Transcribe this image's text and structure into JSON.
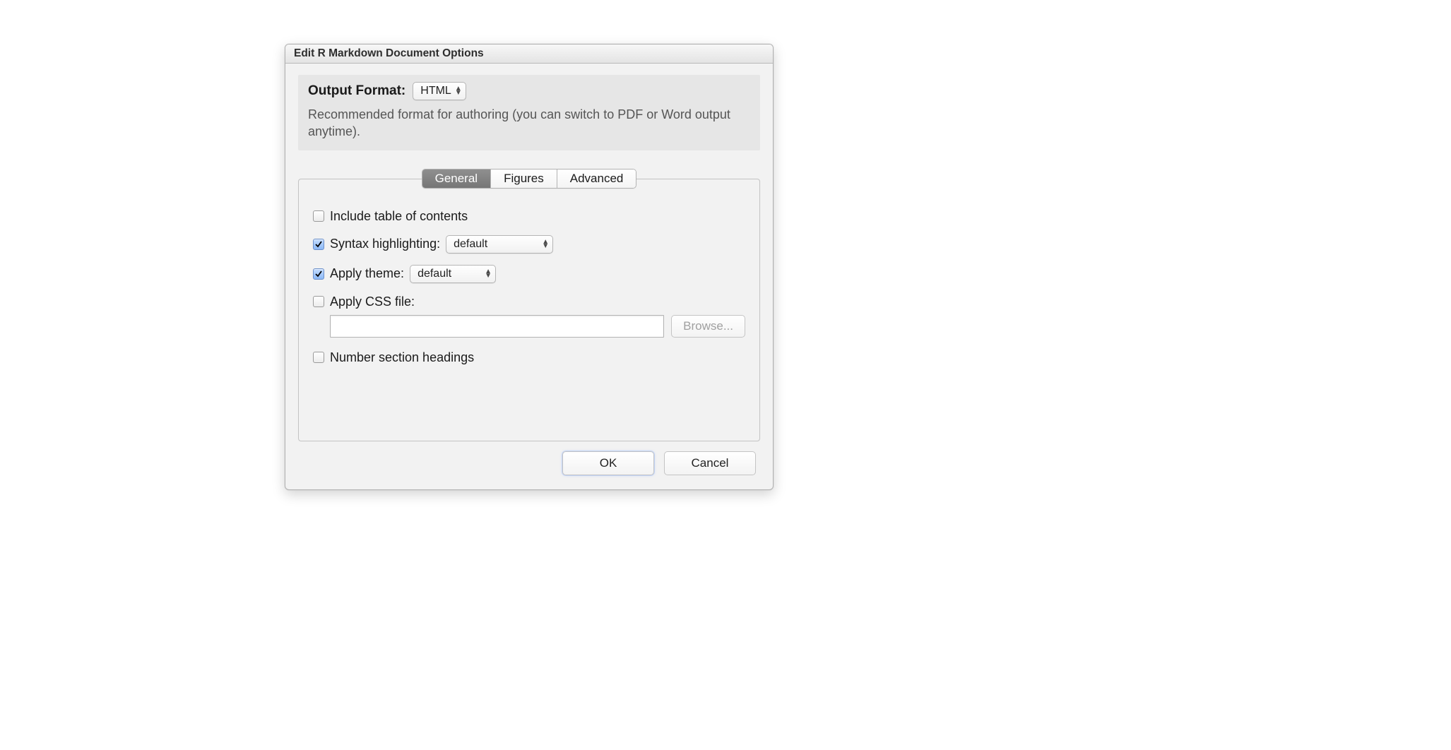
{
  "dialog": {
    "title": "Edit R Markdown Document Options",
    "format_label": "Output Format:",
    "format_value": "HTML",
    "format_description": "Recommended format for authoring (you can switch to PDF or Word output anytime)."
  },
  "tabs": {
    "general": "General",
    "figures": "Figures",
    "advanced": "Advanced"
  },
  "options": {
    "include_toc": {
      "label": "Include table of contents",
      "checked": false
    },
    "syntax_highlighting": {
      "label": "Syntax highlighting:",
      "checked": true,
      "value": "default"
    },
    "apply_theme": {
      "label": "Apply theme:",
      "checked": true,
      "value": "default"
    },
    "apply_css": {
      "label": "Apply CSS file:",
      "checked": false,
      "path": ""
    },
    "browse_label": "Browse...",
    "number_headings": {
      "label": "Number section headings",
      "checked": false
    }
  },
  "buttons": {
    "ok": "OK",
    "cancel": "Cancel"
  }
}
